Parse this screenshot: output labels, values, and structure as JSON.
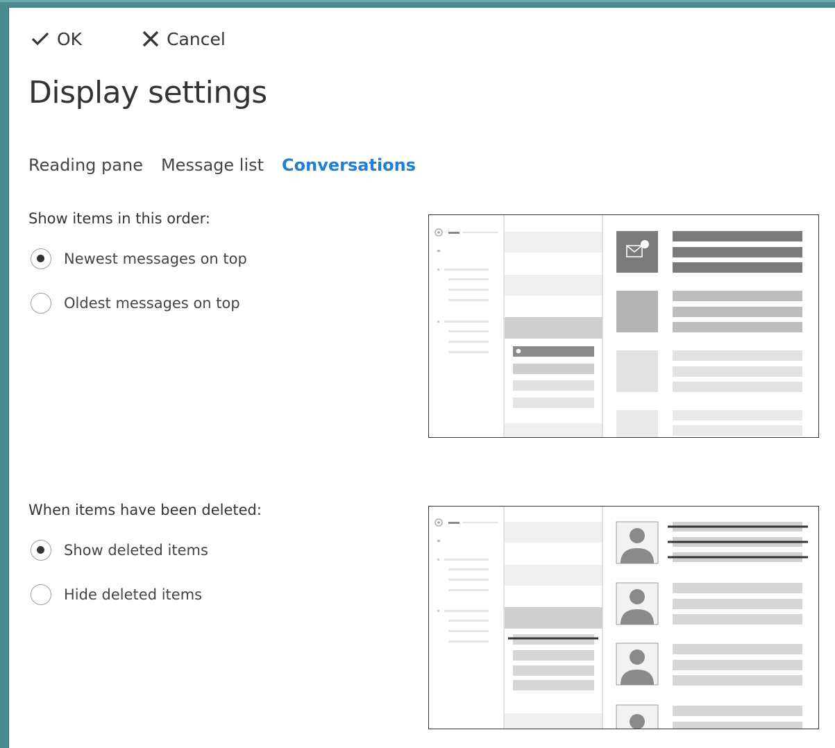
{
  "toolbar": {
    "ok_label": "OK",
    "cancel_label": "Cancel"
  },
  "page": {
    "title": "Display settings"
  },
  "tabs": [
    {
      "label": "Reading pane",
      "active": false
    },
    {
      "label": "Message list",
      "active": false
    },
    {
      "label": "Conversations",
      "active": true
    }
  ],
  "order_section": {
    "label": "Show items in this order:",
    "options": [
      {
        "label": "Newest messages on top",
        "checked": true
      },
      {
        "label": "Oldest messages on top",
        "checked": false
      }
    ]
  },
  "deleted_section": {
    "label": "When items have been deleted:",
    "options": [
      {
        "label": "Show deleted items",
        "checked": true
      },
      {
        "label": "Hide deleted items",
        "checked": false
      }
    ]
  },
  "colors": {
    "accent": "#1e7fd6",
    "frame": "#4a8a90",
    "text": "#333333"
  },
  "icons": {
    "ok": "checkmark-icon",
    "cancel": "close-x-icon"
  }
}
